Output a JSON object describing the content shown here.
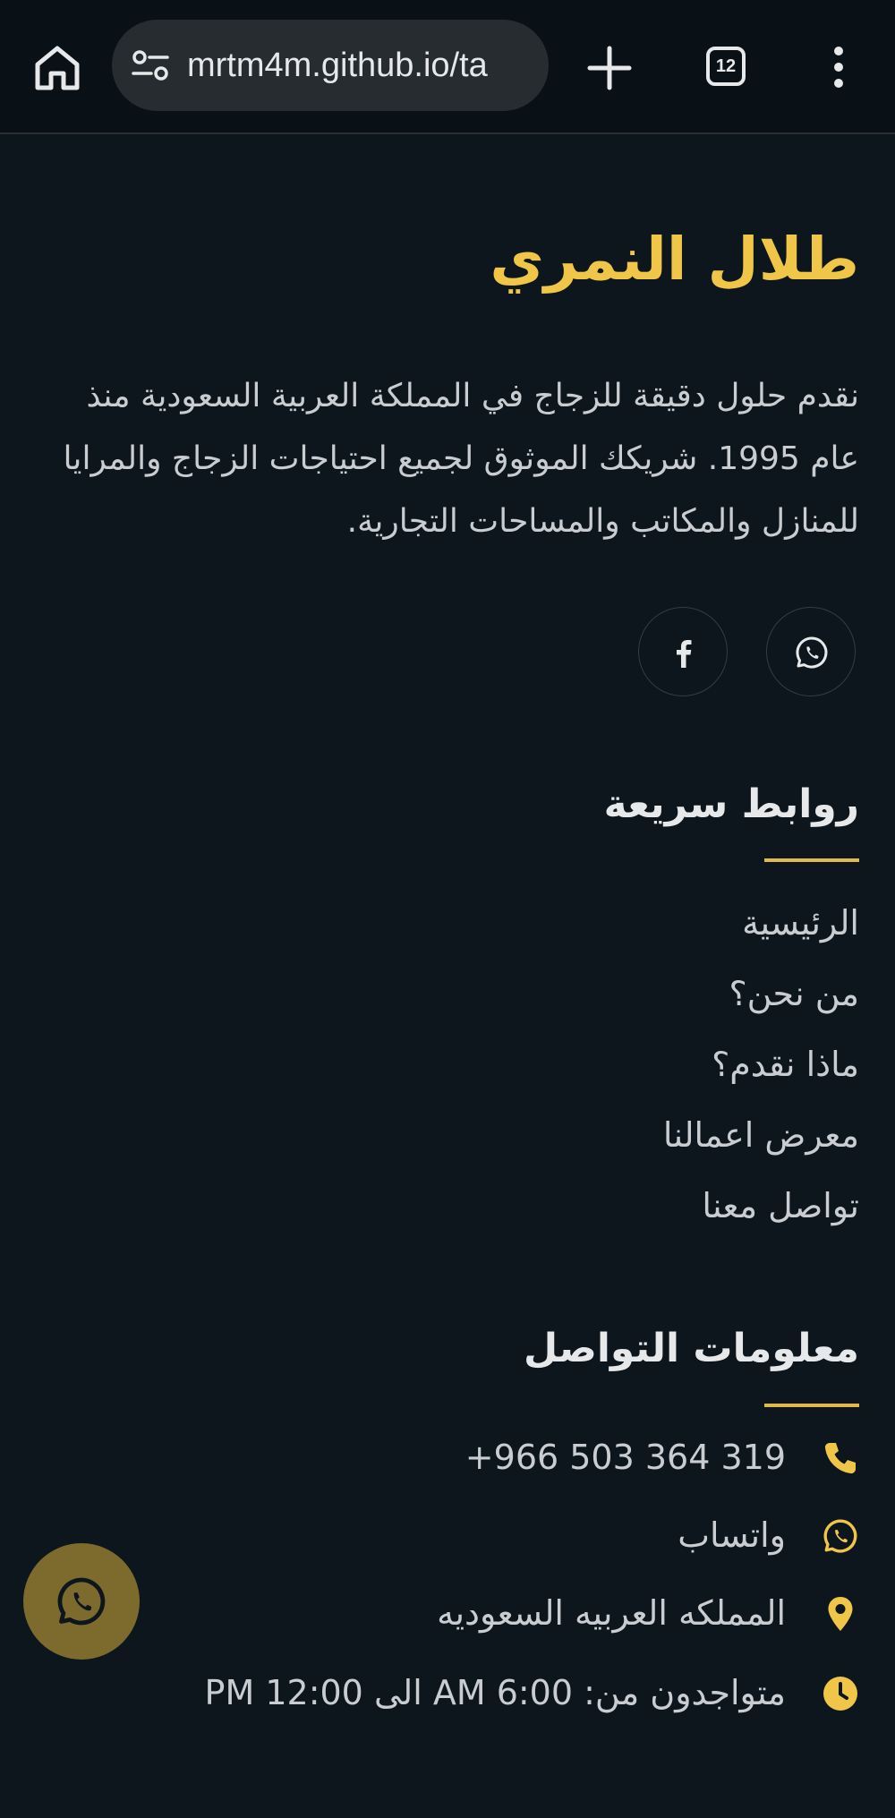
{
  "browser": {
    "url": "mrtm4m.github.io/ta",
    "tab_count": "12"
  },
  "brand": {
    "name": "طلال النمري",
    "description": "نقدم حلول دقيقة للزجاج في المملكة العربية السعودية منذ عام 1995. شريكك الموثوق لجميع احتياجات الزجاج والمرايا للمنازل والمكاتب والمساحات التجارية."
  },
  "social": [
    "whatsapp-icon",
    "facebook-icon"
  ],
  "quick_links": {
    "title": "روابط سريعة",
    "items": [
      "الرئيسية",
      "من نحن؟",
      "ماذا نقدم؟",
      "معرض اعمالنا",
      "تواصل معنا"
    ]
  },
  "contact": {
    "title": "معلومات التواصل",
    "phone": "+966 503 364 319",
    "whatsapp": "واتساب",
    "location": "المملكه العربيه السعوديه",
    "hours": "متواجدون من: 6:00 AM الى 12:00 PM"
  },
  "colors": {
    "accent": "#f0c648",
    "background": "#0d161c",
    "fab": "#7d6b2e"
  }
}
